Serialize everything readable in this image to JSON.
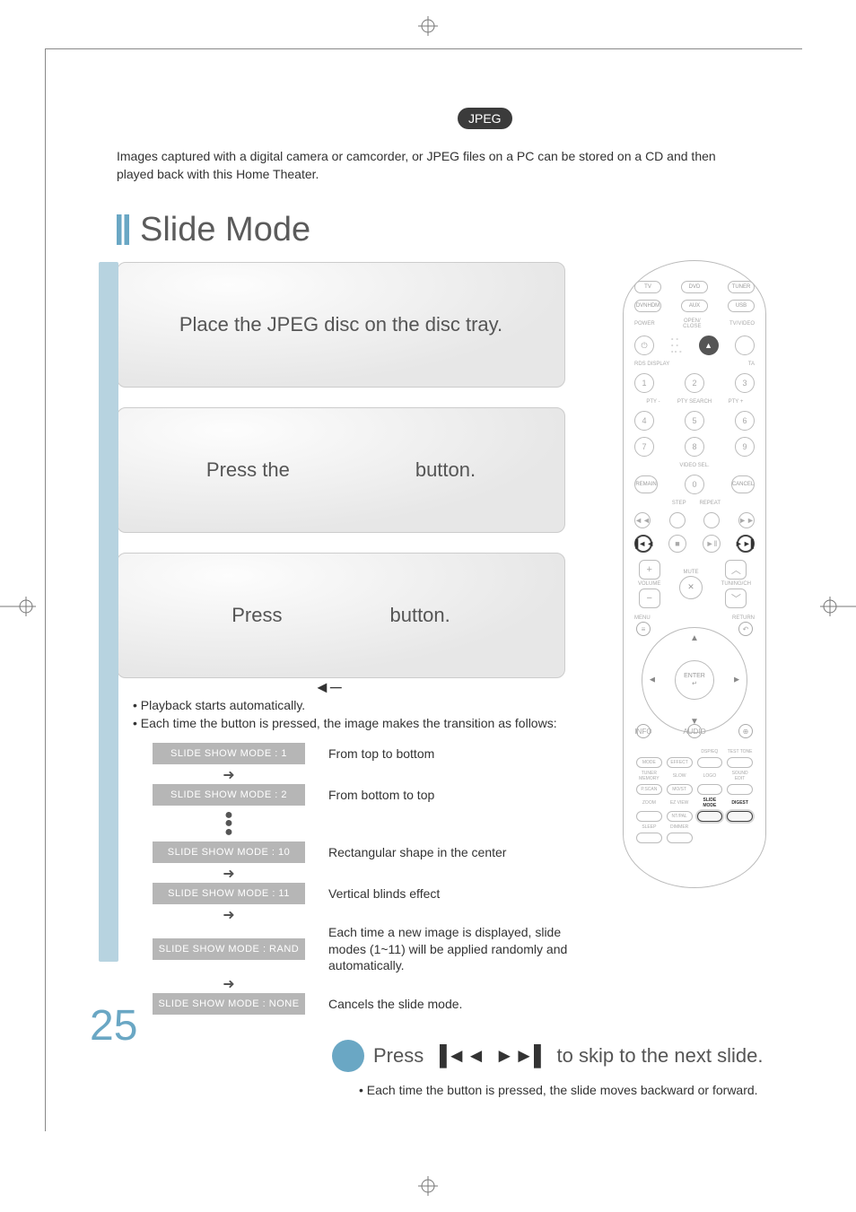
{
  "badge": "JPEG",
  "intro": "Images captured with a digital camera or camcorder, or JPEG files on a PC can be stored on a CD and then played back with this Home Theater.",
  "section_title": "Slide Mode",
  "step1": "Place the JPEG disc on the disc tray.",
  "step2_a": "Press the",
  "step2_b": "button.",
  "step3_a": "Press",
  "step3_b": "button.",
  "bullets": [
    "Playback starts automatically.",
    "Each time the button is pressed, the image makes the transition as follows:"
  ],
  "modes": [
    {
      "chip": "SLIDE SHOW MODE : 1",
      "desc": "From top to bottom",
      "after": "arrow"
    },
    {
      "chip": "SLIDE SHOW MODE : 2",
      "desc": "From bottom to top",
      "after": "dots"
    },
    {
      "chip": "SLIDE SHOW MODE : 10",
      "desc": "Rectangular shape in the center",
      "after": "arrow"
    },
    {
      "chip": "SLIDE SHOW MODE : 11",
      "desc": "Vertical blinds effect",
      "after": "arrow"
    },
    {
      "chip": "SLIDE SHOW MODE : RAND",
      "desc": "Each time a new image is displayed, slide modes (1~11) will be applied randomly and automatically.",
      "after": "arrow"
    },
    {
      "chip": "SLIDE SHOW MODE : NONE",
      "desc": "Cancels the slide mode.",
      "after": "none"
    }
  ],
  "skip": {
    "press": "Press",
    "rest": "to skip to the next slide.",
    "note": "Each time the button is pressed, the slide moves backward or forward."
  },
  "page_number": "25",
  "remote": {
    "source_row1": [
      "TV",
      "DVD",
      "TUNER"
    ],
    "source_row2": [
      "DVNHDM",
      "AUX",
      "USB"
    ],
    "labels": {
      "power": "POWER",
      "openclose": "OPEN/\nCLOSE",
      "tvvideo": "TV/VIDEO",
      "rds": "RDS DISPLAY",
      "ta": "TA",
      "ptyminus": "PTY -",
      "ptysearch": "PTY SEARCH",
      "ptyplus": "PTY +",
      "videosel": "VIDEO SEL.",
      "remain": "REMAIN",
      "cancel": "CANCEL",
      "step": "STEP",
      "repeat": "REPEAT",
      "mute": "MUTE",
      "volume": "VOLUME",
      "tuning": "TUNING/CH",
      "menu": "MENU",
      "return": "RETURN",
      "enter": "ENTER",
      "info": "INFO",
      "audio": "AUDIO"
    },
    "keypad": [
      "1",
      "2",
      "3",
      "4",
      "5",
      "6",
      "7",
      "8",
      "9",
      "0"
    ],
    "bottom_grid": [
      [
        "",
        "DSP/EQ",
        "TEST TONE"
      ],
      [
        "MODE",
        "EFFECT",
        "",
        ""
      ],
      [
        "TUNER MEMORY",
        "SLOW",
        "LOGO",
        "SOUND EDIT"
      ],
      [
        "P.SCAN",
        "MO/ST",
        "",
        ""
      ],
      [
        "ZOOM",
        "EZ VIEW",
        "SLIDE MODE",
        "DIGEST"
      ],
      [
        "",
        "NT/PAL",
        "",
        ""
      ],
      [
        "SLEEP",
        "DIMMER",
        "",
        ""
      ]
    ],
    "highlight": {
      "slidemode": "SLIDE MODE",
      "digest": "DIGEST"
    }
  }
}
